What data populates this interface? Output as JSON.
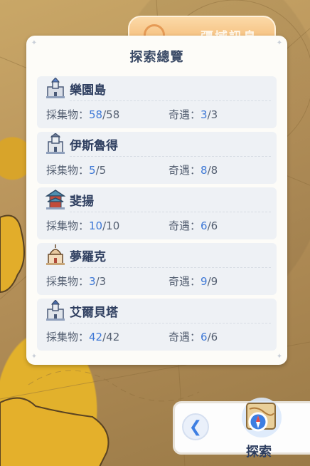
{
  "panel": {
    "title": "探索總覽",
    "collect_label": "採集物：",
    "encounter_label": "奇遇：",
    "rows": [
      {
        "name": "樂園島",
        "collect_current": "58",
        "collect_total": "/58",
        "encounter_current": "3",
        "encounter_total": "/3",
        "icon": "castle-icon"
      },
      {
        "name": "伊斯魯得",
        "collect_current": "5",
        "collect_total": "/5",
        "encounter_current": "8",
        "encounter_total": "/8",
        "icon": "castle-icon"
      },
      {
        "name": "斐揚",
        "collect_current": "10",
        "collect_total": "/10",
        "encounter_current": "6",
        "encounter_total": "/6",
        "icon": "pagoda-icon"
      },
      {
        "name": "夢羅克",
        "collect_current": "3",
        "collect_total": "/3",
        "encounter_current": "9",
        "encounter_total": "/9",
        "icon": "temple-icon"
      },
      {
        "name": "艾爾貝塔",
        "collect_current": "42",
        "collect_total": "/42",
        "encounter_current": "6",
        "encounter_total": "/6",
        "icon": "castle-icon"
      }
    ]
  },
  "top_banner": {
    "text": "疆域訊息"
  },
  "explore": {
    "label": "探索",
    "back_icon": "chevron-left-icon",
    "icon": "map-compass-icon"
  },
  "colors": {
    "accent": "#3f79d6",
    "title": "#2f3f60"
  }
}
